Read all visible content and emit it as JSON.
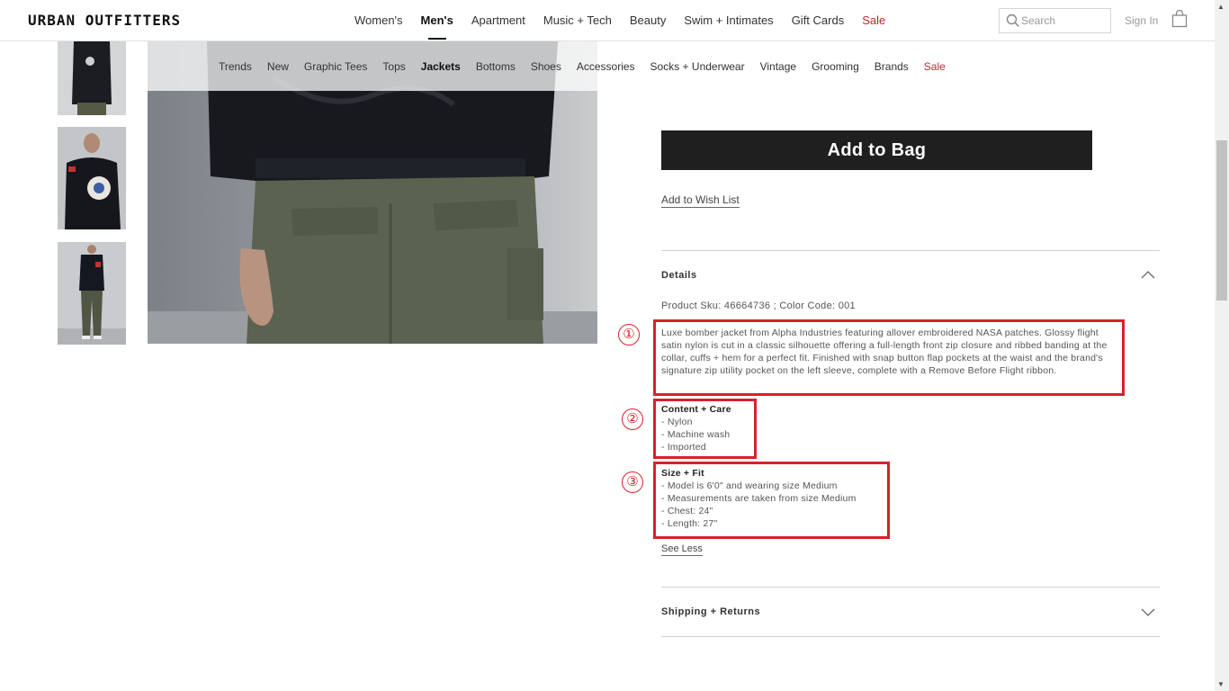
{
  "header": {
    "logo": "URBAN OUTFITTERS",
    "primary_nav": [
      {
        "label": "Women's",
        "active": false,
        "sale": false
      },
      {
        "label": "Men's",
        "active": true,
        "sale": false
      },
      {
        "label": "Apartment",
        "active": false,
        "sale": false
      },
      {
        "label": "Music + Tech",
        "active": false,
        "sale": false
      },
      {
        "label": "Beauty",
        "active": false,
        "sale": false
      },
      {
        "label": "Swim + Intimates",
        "active": false,
        "sale": false
      },
      {
        "label": "Gift Cards",
        "active": false,
        "sale": false
      },
      {
        "label": "Sale",
        "active": false,
        "sale": true
      }
    ],
    "search_placeholder": "Search",
    "sign_in": "Sign In",
    "bag_icon": "shopping-bag-icon"
  },
  "subnav": {
    "items": [
      {
        "label": "Trends",
        "active": false,
        "sale": false
      },
      {
        "label": "New",
        "active": false,
        "sale": false
      },
      {
        "label": "Graphic Tees",
        "active": false,
        "sale": false
      },
      {
        "label": "Tops",
        "active": false,
        "sale": false
      },
      {
        "label": "Jackets",
        "active": true,
        "sale": false
      },
      {
        "label": "Bottoms",
        "active": false,
        "sale": false
      },
      {
        "label": "Shoes",
        "active": false,
        "sale": false
      },
      {
        "label": "Accessories",
        "active": false,
        "sale": false
      },
      {
        "label": "Socks + Underwear",
        "active": false,
        "sale": false
      },
      {
        "label": "Vintage",
        "active": false,
        "sale": false
      },
      {
        "label": "Grooming",
        "active": false,
        "sale": false
      },
      {
        "label": "Brands",
        "active": false,
        "sale": false
      },
      {
        "label": "Sale",
        "active": false,
        "sale": true
      }
    ]
  },
  "product": {
    "add_to_bag": "Add to Bag",
    "add_to_wishlist": "Add to Wish List",
    "details_title": "Details",
    "sku_line": "Product Sku: 46664736 ; Color Code: 001",
    "description": "Luxe bomber jacket from Alpha Industries featuring allover embroidered NASA patches. Glossy flight satin nylon is cut in a classic silhouette offering a full-length front zip closure and ribbed banding at the collar, cuffs + hem for a perfect fit. Finished with snap button flap pockets at the waist and the brand's signature zip utility pocket on the left sleeve, complete with a Remove Before Flight ribbon.",
    "content_care": {
      "title": "Content + Care",
      "items": [
        "- Nylon",
        "- Machine wash",
        "- Imported"
      ]
    },
    "size_fit": {
      "title": "Size + Fit",
      "items": [
        "- Model is 6'0\" and wearing size Medium",
        "- Measurements are taken from size Medium",
        "- Chest: 24\"",
        "- Length: 27\""
      ]
    },
    "see_less": "See Less",
    "shipping_title": "Shipping + Returns"
  },
  "annotations": {
    "one": "①",
    "two": "②",
    "three": "③",
    "color": "#d6222c"
  }
}
